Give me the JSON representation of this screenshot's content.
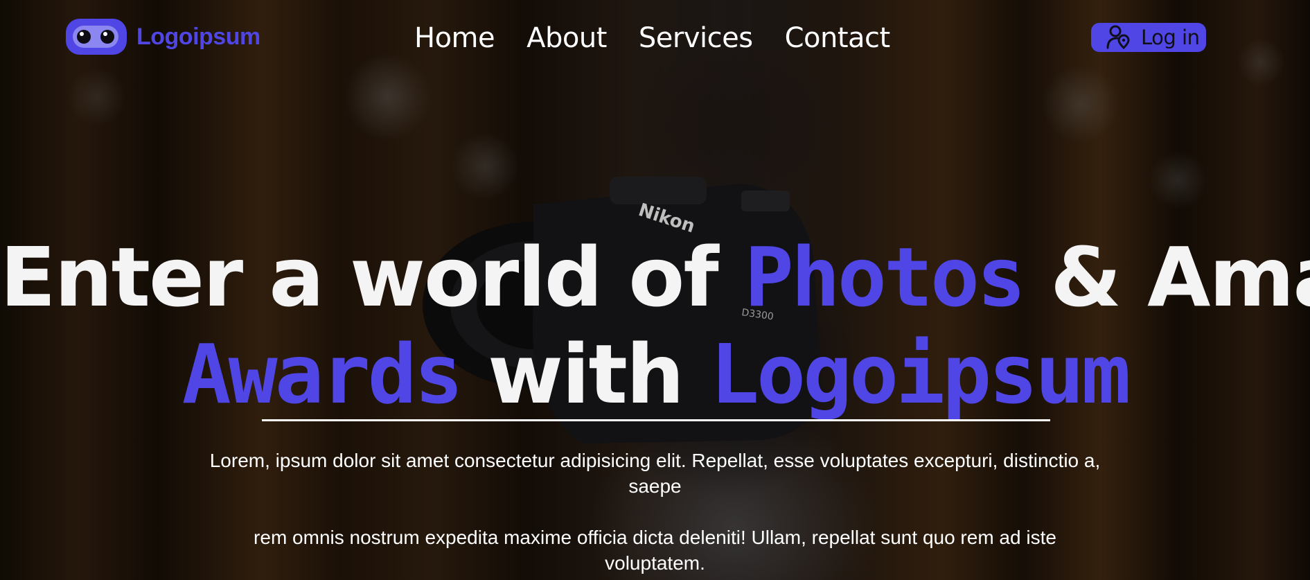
{
  "brand": {
    "name": "Logoipsum",
    "accent_color": "#4f46e5",
    "logo_icon": "robot-eyes-logo-icon"
  },
  "nav": {
    "links": [
      {
        "label": "Home"
      },
      {
        "label": "About"
      },
      {
        "label": "Services"
      },
      {
        "label": "Contact"
      }
    ]
  },
  "login": {
    "label": "Log in",
    "icon": "user-location-icon"
  },
  "hero": {
    "background": "blurred forest photo with person tossing a camera",
    "camera_brand": "Nikon",
    "camera_model": "D3300",
    "headline": {
      "line1": [
        {
          "text": "Enter a world of ",
          "style": "white"
        },
        {
          "text": "Photos",
          "style": "accent"
        },
        {
          "text": " & Amazing",
          "style": "white"
        }
      ],
      "line2": [
        {
          "text": "Awards",
          "style": "accent"
        },
        {
          "text": " with ",
          "style": "white"
        },
        {
          "text": "Logoipsum",
          "style": "accent"
        }
      ]
    },
    "paragraph1": "Lorem, ipsum dolor sit amet consectetur adipisicing elit. Repellat, esse voluptates excepturi, distinctio a, saepe",
    "paragraph2": "rem omnis nostrum expedita maxime officia dicta deleniti! Ullam, repellat sunt quo rem ad iste voluptatem."
  }
}
